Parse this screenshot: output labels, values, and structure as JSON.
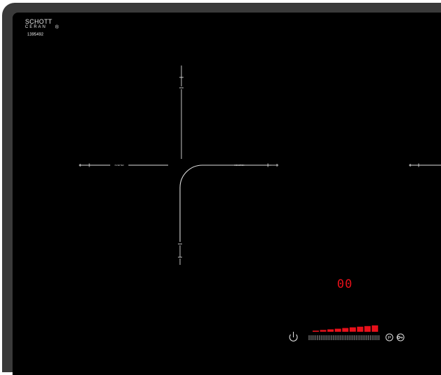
{
  "brand": {
    "name": "SCHOTT",
    "sub": "CERAN",
    "registered": "®"
  },
  "serial": "1395492",
  "zones": {
    "left_label": "INVERTER",
    "right_label": "INDUCTION"
  },
  "display": {
    "value": "00"
  },
  "controls": {
    "power_level_segments": 9,
    "active_segments": 9,
    "slider_ticks": 36
  },
  "colors": {
    "frame": "#3a3a3a",
    "glass": "#000000",
    "print": "#e8e8e8",
    "display_red": "#e8101a"
  },
  "icons": [
    "power-icon",
    "pause-icon",
    "lock-icon"
  ]
}
